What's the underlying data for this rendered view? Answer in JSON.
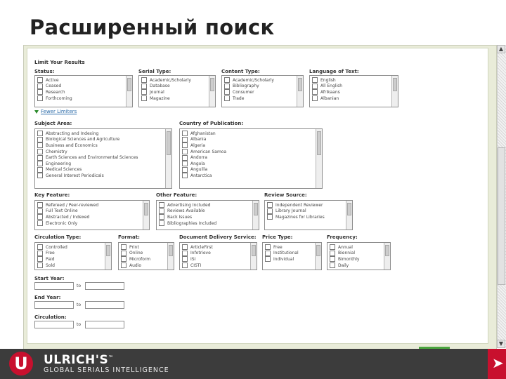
{
  "slide": {
    "title": "Расширенный поиск"
  },
  "form": {
    "heading": "Limit Your Results",
    "groups": [
      {
        "key": "status",
        "label": "Status:",
        "options": [
          "Active",
          "Ceased",
          "Research",
          "Forthcoming"
        ]
      },
      {
        "key": "serial_type",
        "label": "Serial Type:",
        "options": [
          "Academic/Scholarly",
          "Database",
          "Journal",
          "Magazine"
        ]
      },
      {
        "key": "content_type",
        "label": "Content Type:",
        "options": [
          "Academic/Scholarly",
          "Bibliography",
          "Consumer",
          "Trade"
        ]
      },
      {
        "key": "language",
        "label": "Language of Text:",
        "options": [
          "English",
          "All English",
          "Afrikaans",
          "Albanian"
        ]
      },
      {
        "key": "subject",
        "label": "Subject Area:",
        "options": [
          "Abstracting and Indexing",
          "Biological Sciences and Agriculture",
          "Business and Economics",
          "Chemistry",
          "Earth Sciences and Environmental Sciences",
          "Engineering",
          "Medical Sciences",
          "General Interest Periodicals"
        ]
      },
      {
        "key": "country",
        "label": "Country of Publication:",
        "options": [
          "Afghanistan",
          "Albania",
          "Algeria",
          "American Samoa",
          "Andorra",
          "Angola",
          "Anguilla",
          "Antarctica"
        ]
      },
      {
        "key": "key_feature",
        "label": "Key Feature:",
        "options": [
          "Refereed / Peer-reviewed",
          "Full Text Online",
          "Abstracted / Indexed",
          "Electronic Only"
        ]
      },
      {
        "key": "other_feature",
        "label": "Other Feature:",
        "options": [
          "Advertising Included",
          "Reviews Available",
          "Back Issues",
          "Bibliographies Included"
        ]
      },
      {
        "key": "review_source",
        "label": "Review Source:",
        "options": [
          "Independent Reviewer",
          "Library Journal",
          "Magazines for Libraries"
        ]
      },
      {
        "key": "circulation_type",
        "label": "Circulation Type:",
        "options": [
          "Controlled",
          "Free",
          "Paid",
          "Sold"
        ]
      },
      {
        "key": "format",
        "label": "Format:",
        "options": [
          "Print",
          "Online",
          "Microform",
          "Audio"
        ]
      },
      {
        "key": "document_delivery",
        "label": "Document Delivery Service:",
        "options": [
          "ArticleFirst",
          "Infotrieve",
          "ISI",
          "CISTI"
        ]
      },
      {
        "key": "price_type",
        "label": "Price Type:",
        "options": [
          "Free",
          "Institutional",
          "Individual"
        ]
      },
      {
        "key": "frequency",
        "label": "Frequency:",
        "options": [
          "Annual",
          "Biennial",
          "Bimonthly",
          "Daily"
        ]
      }
    ],
    "fewer_limiters": "Fewer Limiters",
    "start_year": {
      "label": "Start Year:",
      "to": "to"
    },
    "end_year": {
      "label": "End Year:",
      "to": "to"
    },
    "circulation": {
      "label": "Circulation:",
      "to": "to"
    }
  },
  "footer": {
    "brand": "ULRICH'S",
    "tm": "™",
    "tagline": "GLOBAL SERIALS INTELLIGENCE",
    "logo_letter": "U"
  },
  "colors": {
    "footer_bg": "#3c3c3c",
    "brand_red": "#c8102e",
    "link": "#2a6aa8",
    "panel_bg": "#e9ecd9"
  }
}
